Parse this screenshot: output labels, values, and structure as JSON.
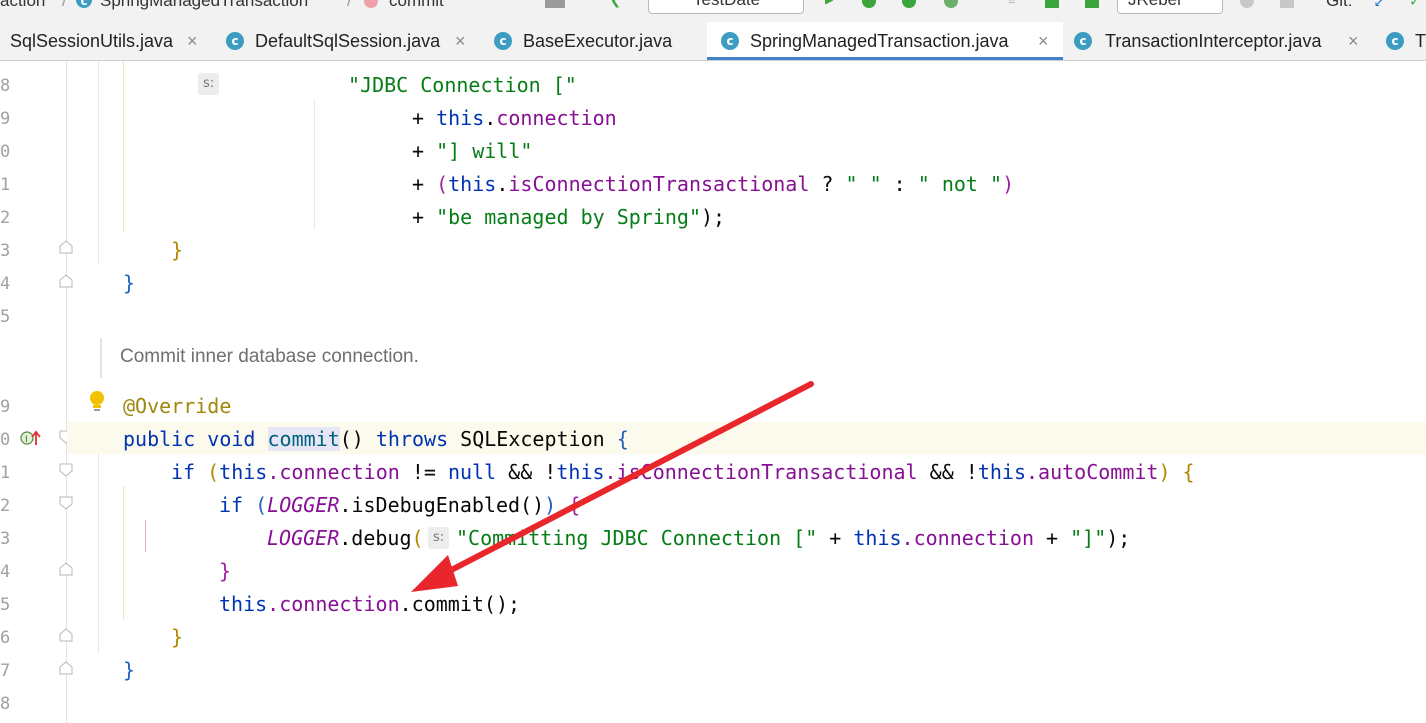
{
  "breadcrumb": {
    "items": [
      "action",
      "SpringManagedTransaction",
      "commit"
    ]
  },
  "toolbar": {
    "run_config": "TestDate",
    "jrebel": "JRebel",
    "git_label": "Git:"
  },
  "tabs": [
    {
      "label": "SqlSessionUtils.java",
      "icon": "class-icon",
      "active": false
    },
    {
      "label": "DefaultSqlSession.java",
      "icon": "class-icon",
      "active": false
    },
    {
      "label": "BaseExecutor.java",
      "icon": "class-icon",
      "active": false
    },
    {
      "label": "SpringManagedTransaction.java",
      "icon": "class-icon",
      "active": true
    },
    {
      "label": "TransactionInterceptor.java",
      "icon": "class-icon",
      "active": false
    },
    {
      "label": "T",
      "icon": "class-icon",
      "active": false
    }
  ],
  "gutter": {
    "line_numbers": [
      "8",
      "9",
      "0",
      "1",
      "2",
      "3",
      "4",
      "5",
      "9",
      "0",
      "1",
      "2",
      "3",
      "4",
      "5",
      "6",
      "7",
      "8"
    ]
  },
  "code": {
    "hint_s": "s:",
    "l1_str": "\"JDBC Connection [\"",
    "l2_plus": "+ ",
    "l2_this": "this",
    "l2_dot": ".",
    "l2_field": "connection",
    "l3_plus": "+ ",
    "l3_str": "\"] will\"",
    "l4_plus": "+ ",
    "l4_open": "(",
    "l4_this": "this",
    "l4_dot": ".",
    "l4_field": "isConnectionTransactional",
    "l4_q": " ? ",
    "l4_s1": "\" \"",
    "l4_colon": " : ",
    "l4_s2": "\" not \"",
    "l4_close": ")",
    "l5_plus": "+ ",
    "l5_str": "\"be managed by Spring\"",
    "l5_end": ");",
    "l6_brace": "}",
    "l7_brace": "}",
    "doc_comment": "Commit inner database connection.",
    "annotation": "@Override",
    "sig_public": "public void ",
    "sig_method": "commit",
    "sig_parens": "() ",
    "sig_throws": "throws ",
    "sig_exc": "SQLException ",
    "sig_brace": "{",
    "if1_kw": "if ",
    "if1_open": "(",
    "if1_this1": "this",
    "if1_conn": ".connection",
    "if1_ne": " != ",
    "if1_null": "null",
    "if1_and1": " && !",
    "if1_this2": "this",
    "if1_ict": ".isConnectionTransactional",
    "if1_and2": " && !",
    "if1_this3": "this",
    "if1_auto": ".autoCommit",
    "if1_close": ") ",
    "if1_brace": "{",
    "if2_kw": "if ",
    "if2_open": "(",
    "if2_logger": "LOGGER",
    "if2_call": ".isDebugEnabled()",
    "if2_close": ") ",
    "if2_brace": "{",
    "dbg_logger": "LOGGER",
    "dbg_call": ".debug",
    "dbg_open": "(",
    "dbg_str": "\"Committing JDBC Connection [\"",
    "dbg_plus1": " + ",
    "dbg_this": "this",
    "dbg_conn": ".connection",
    "dbg_plus2": " + ",
    "dbg_str2": "\"]\"",
    "dbg_end": ");",
    "cb1": "}",
    "cm_this": "this",
    "cm_conn": ".connection",
    "cm_rest": ".commit();",
    "cb2": "}",
    "cb3": "}"
  },
  "colors": {
    "keyword": "#0033b3",
    "string": "#067d17",
    "field": "#871094",
    "annotation": "#9e880d",
    "arrow": "#e8262b",
    "active_tab_underline": "#4083c9"
  }
}
